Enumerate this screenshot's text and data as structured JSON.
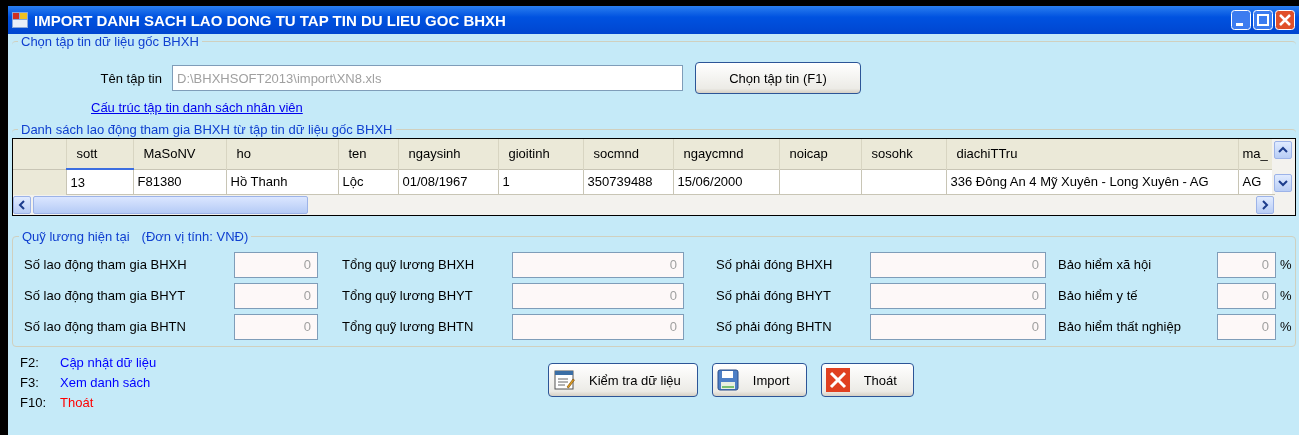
{
  "window": {
    "title": "IMPORT DANH SACH LAO DONG TU TAP TIN DU LIEU GOC BHXH"
  },
  "file_group": {
    "legend": "Chọn tập tin dữ liệu gốc BHXH",
    "filename_label": "Tên tập tin",
    "filename_value": "D:\\BHXHSOFT2013\\import\\XN8.xls",
    "choose_button": "Chọn tập tin (F1)",
    "structure_link": "Cấu trúc tập tin danh sách nhân viên"
  },
  "grid_group": {
    "legend": "Danh sách lao động tham gia BHXH từ tập tin dữ liệu gốc BHXH",
    "columns": [
      "sott",
      "MaSoNV",
      "ho",
      "ten",
      "ngaysinh",
      "gioitinh",
      "socmnd",
      "ngaycmnd",
      "noicap",
      "sosohk",
      "diachiTTru",
      "ma_"
    ],
    "rows": [
      [
        "13",
        "F81380",
        "Hồ Thanh",
        "Lộc",
        "01/08/1967",
        "1",
        "350739488",
        "15/06/2000",
        "",
        "",
        "336 Đông An 4 Mỹ Xuyên - Long Xuyên - AG",
        "AG"
      ]
    ]
  },
  "summary_group": {
    "legend": "Quỹ lương hiện tại",
    "unit": "(Đơn vị tính: VNĐ)",
    "rows": [
      [
        {
          "label": "Số lao động tham gia BHXH",
          "value": "0"
        },
        {
          "label": "Tổng quỹ lương BHXH",
          "value": "0"
        },
        {
          "label": "Số phải đóng BHXH",
          "value": "0"
        },
        {
          "label": "Bảo hiểm xã hội",
          "value": "0",
          "suffix": "%"
        }
      ],
      [
        {
          "label": "Số lao động tham gia BHYT",
          "value": "0"
        },
        {
          "label": "Tổng quỹ lương BHYT",
          "value": "0"
        },
        {
          "label": "Số phải đóng BHYT",
          "value": "0"
        },
        {
          "label": "Bảo hiểm y tế",
          "value": "0",
          "suffix": "%"
        }
      ],
      [
        {
          "label": "Số lao động tham gia BHTN",
          "value": "0"
        },
        {
          "label": "Tổng quỹ lương BHTN",
          "value": "0"
        },
        {
          "label": "Số phải đóng BHTN",
          "value": "0"
        },
        {
          "label": "Bảo hiểm thất nghiệp",
          "value": "0",
          "suffix": "%"
        }
      ]
    ]
  },
  "shortcuts": [
    {
      "key": "F2:",
      "label": "Cập nhật dữ liệu",
      "color": "#0000ff"
    },
    {
      "key": "F3:",
      "label": "Xem danh sách",
      "color": "#0000ff"
    },
    {
      "key": "F10:",
      "label": "Thoát",
      "color": "#ff0000"
    }
  ],
  "buttons": [
    {
      "label": "Kiểm tra dữ liệu",
      "kind": "check"
    },
    {
      "label": "Import",
      "kind": "save"
    },
    {
      "label": "Thoát",
      "kind": "exit"
    }
  ]
}
